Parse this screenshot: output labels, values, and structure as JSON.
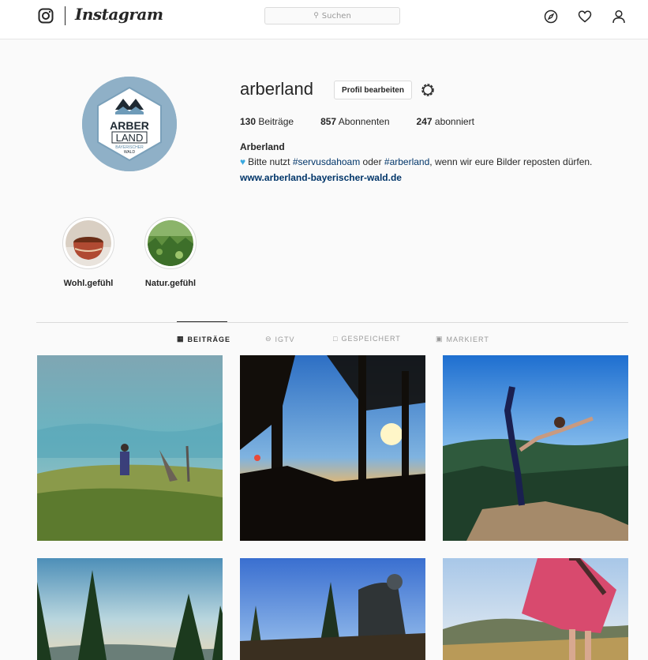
{
  "nav": {
    "wordmark": "Instagram",
    "search_placeholder": "Suchen",
    "icons": [
      "instagram-logo-icon",
      "compass-icon",
      "heart-icon",
      "user-icon"
    ]
  },
  "profile": {
    "username": "arberland",
    "edit_button": "Profil bearbeiten",
    "avatar_text": {
      "line1": "ARBER",
      "line2": "LAND",
      "line3": "BAYERISCHER",
      "line4": "WALD"
    },
    "stats": {
      "posts_count": "130",
      "posts_label": "Beiträge",
      "followers_count": "857",
      "followers_label": "Abonnenten",
      "following_count": "247",
      "following_label": "abonniert"
    },
    "bio": {
      "name": "Arberland",
      "text_1": "Bitte nutzt ",
      "tag_1": "#servusdahoam",
      "text_2": " oder ",
      "tag_2": "#arberland",
      "text_3": ", wenn wir eure Bilder reposten dürfen.",
      "link": "www.arberland-bayerischer-wald.de"
    }
  },
  "highlights": [
    {
      "label": "Wohl.gefühl"
    },
    {
      "label": "Natur.gefühl"
    }
  ],
  "tabs": [
    {
      "label": "BEITRÄGE",
      "active": true
    },
    {
      "label": "IGTV",
      "active": false
    },
    {
      "label": "GESPEICHERT",
      "active": false
    },
    {
      "label": "MARKIERT",
      "active": false
    }
  ],
  "colors": {
    "link": "#003569",
    "avatar_ring": "#8fb0c7",
    "heart_emoji": "#3aa9e0"
  }
}
